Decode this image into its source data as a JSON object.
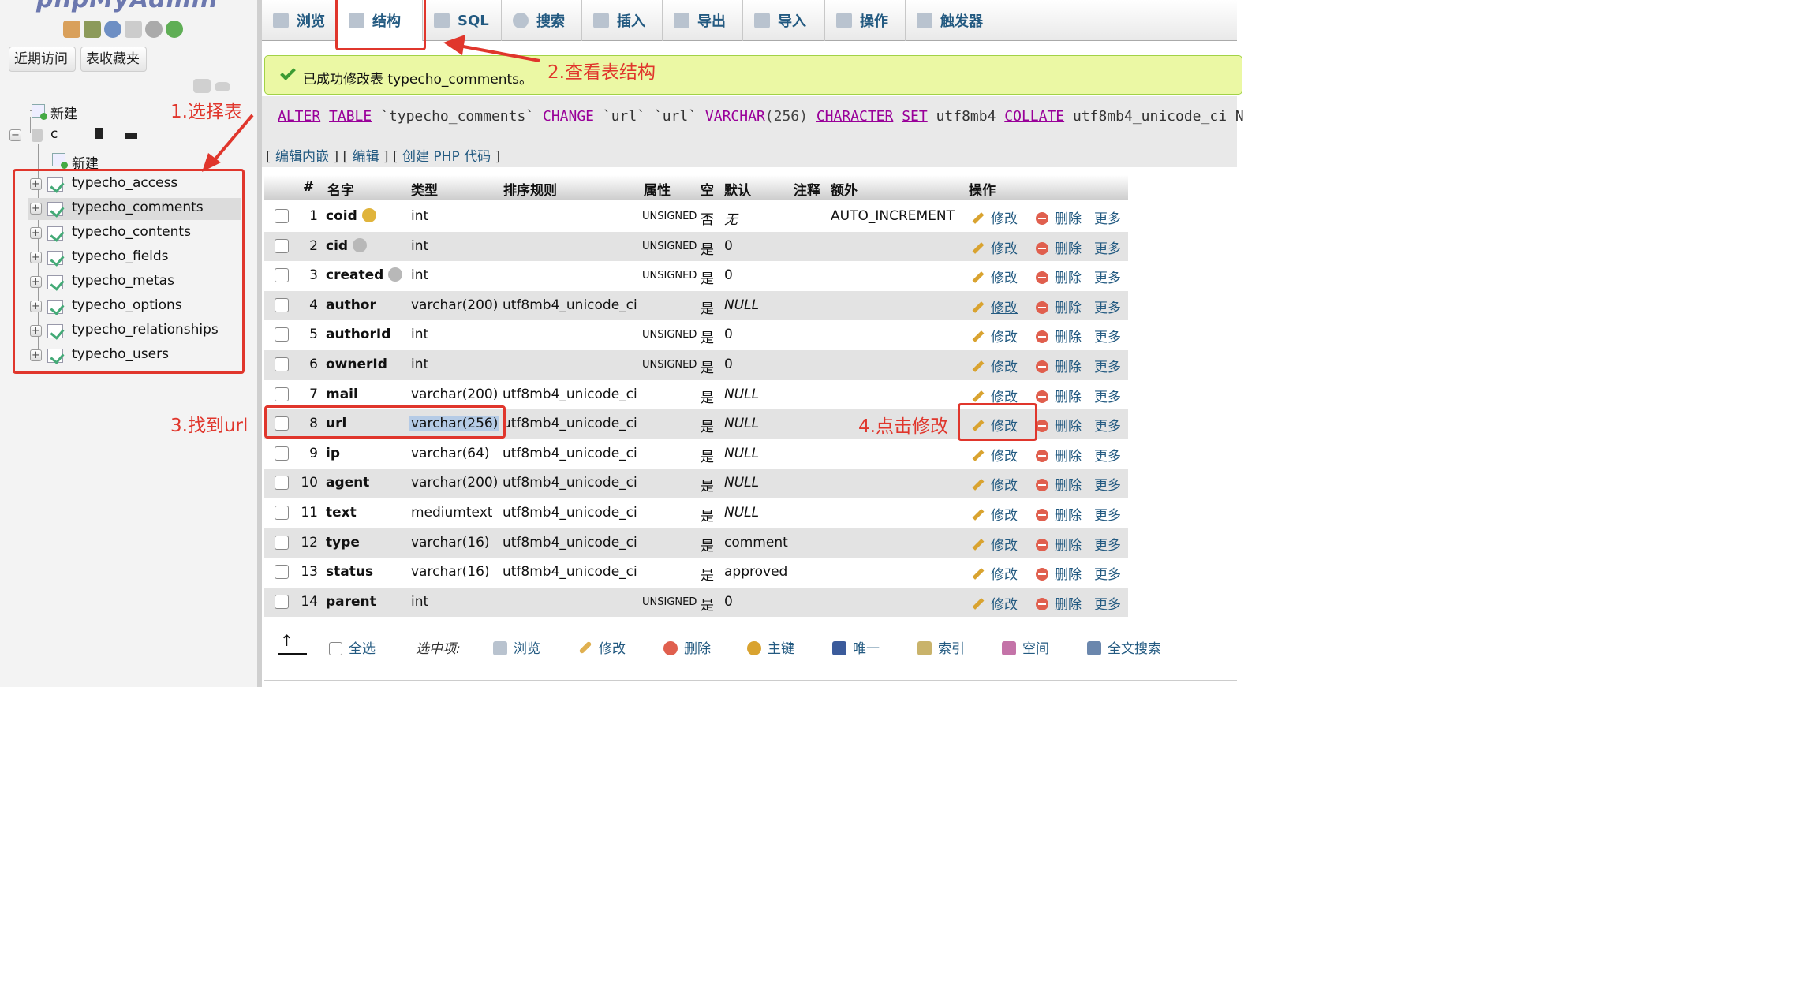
{
  "sidebar": {
    "logo": "phpMyAdmin",
    "buttons": {
      "recent": "近期访问",
      "favorites": "表收藏夹"
    },
    "tree": {
      "new_root": "新建",
      "db_name": "c",
      "new_in_db": "新建",
      "tables": [
        "typecho_access",
        "typecho_comments",
        "typecho_contents",
        "typecho_fields",
        "typecho_metas",
        "typecho_options",
        "typecho_relationships",
        "typecho_users"
      ],
      "selected_table": "typecho_comments"
    }
  },
  "tabs": [
    {
      "label": "浏览",
      "icon": "browse-icon"
    },
    {
      "label": "结构",
      "icon": "structure-icon"
    },
    {
      "label": "SQL",
      "icon": "sql-icon"
    },
    {
      "label": "搜索",
      "icon": "search-icon"
    },
    {
      "label": "插入",
      "icon": "insert-icon"
    },
    {
      "label": "导出",
      "icon": "export-icon"
    },
    {
      "label": "导入",
      "icon": "import-icon"
    },
    {
      "label": "操作",
      "icon": "wrench-icon"
    },
    {
      "label": "触发器",
      "icon": "trigger-icon"
    }
  ],
  "message": {
    "success": "已成功修改表 typecho_comments。",
    "sql": {
      "alter": "ALTER",
      "table": "TABLE",
      "tbl": "`typecho_comments`",
      "change": "CHANGE",
      "col1": "`url`",
      "col2": "`url`",
      "type": "VARCHAR",
      "len": "(256)",
      "character": "CHARACTER",
      "set": "SET",
      "charset": "utf8mb4",
      "collate": "COLLATE",
      "collation": "utf8mb4_unicode_ci",
      "tail": "N"
    },
    "links": {
      "inline_edit": "编辑内嵌",
      "edit": "编辑",
      "php_code": "创建 PHP 代码"
    }
  },
  "structure": {
    "headers": {
      "num": "#",
      "name": "名字",
      "type": "类型",
      "collation": "排序规则",
      "attributes": "属性",
      "null": "空",
      "default": "默认",
      "comment": "注释",
      "extra": "额外",
      "action": "操作"
    },
    "actions": {
      "edit": "修改",
      "delete": "删除",
      "more": "更多"
    },
    "rows": [
      {
        "num": "1",
        "name": "coid",
        "type": "int",
        "collation": "",
        "attr": "UNSIGNED",
        "null": "否",
        "default": "无",
        "extra": "AUTO_INCREMENT",
        "key": "primary"
      },
      {
        "num": "2",
        "name": "cid",
        "type": "int",
        "collation": "",
        "attr": "UNSIGNED",
        "null": "是",
        "default": "0",
        "extra": "",
        "key": "index"
      },
      {
        "num": "3",
        "name": "created",
        "type": "int",
        "collation": "",
        "attr": "UNSIGNED",
        "null": "是",
        "default": "0",
        "extra": "",
        "key": "index"
      },
      {
        "num": "4",
        "name": "author",
        "type": "varchar(200)",
        "collation": "utf8mb4_unicode_ci",
        "attr": "",
        "null": "是",
        "default": "NULL",
        "extra": "",
        "key": ""
      },
      {
        "num": "5",
        "name": "authorId",
        "type": "int",
        "collation": "",
        "attr": "UNSIGNED",
        "null": "是",
        "default": "0",
        "extra": "",
        "key": ""
      },
      {
        "num": "6",
        "name": "ownerId",
        "type": "int",
        "collation": "",
        "attr": "UNSIGNED",
        "null": "是",
        "default": "0",
        "extra": "",
        "key": ""
      },
      {
        "num": "7",
        "name": "mail",
        "type": "varchar(200)",
        "collation": "utf8mb4_unicode_ci",
        "attr": "",
        "null": "是",
        "default": "NULL",
        "extra": "",
        "key": ""
      },
      {
        "num": "8",
        "name": "url",
        "type": "varchar(256)",
        "collation": "utf8mb4_unicode_ci",
        "attr": "",
        "null": "是",
        "default": "NULL",
        "extra": "",
        "key": ""
      },
      {
        "num": "9",
        "name": "ip",
        "type": "varchar(64)",
        "collation": "utf8mb4_unicode_ci",
        "attr": "",
        "null": "是",
        "default": "NULL",
        "extra": "",
        "key": ""
      },
      {
        "num": "10",
        "name": "agent",
        "type": "varchar(200)",
        "collation": "utf8mb4_unicode_ci",
        "attr": "",
        "null": "是",
        "default": "NULL",
        "extra": "",
        "key": ""
      },
      {
        "num": "11",
        "name": "text",
        "type": "mediumtext",
        "collation": "utf8mb4_unicode_ci",
        "attr": "",
        "null": "是",
        "default": "NULL",
        "extra": "",
        "key": ""
      },
      {
        "num": "12",
        "name": "type",
        "type": "varchar(16)",
        "collation": "utf8mb4_unicode_ci",
        "attr": "",
        "null": "是",
        "default": "comment",
        "extra": "",
        "key": ""
      },
      {
        "num": "13",
        "name": "status",
        "type": "varchar(16)",
        "collation": "utf8mb4_unicode_ci",
        "attr": "",
        "null": "是",
        "default": "approved",
        "extra": "",
        "key": ""
      },
      {
        "num": "14",
        "name": "parent",
        "type": "int",
        "collation": "",
        "attr": "UNSIGNED",
        "null": "是",
        "default": "0",
        "extra": "",
        "key": ""
      }
    ]
  },
  "bulk": {
    "select_all": "全选",
    "with_selected": "选中项:",
    "browse": "浏览",
    "edit": "修改",
    "delete": "删除",
    "primary": "主键",
    "unique": "唯一",
    "index": "索引",
    "spatial": "空间",
    "fulltext": "全文搜索"
  },
  "annotations": {
    "step1": "1.选择表",
    "step2": "2.查看表结构",
    "step3": "3.找到url",
    "step4": "4.点击修改"
  },
  "colors": {
    "annotation": "#e0362c",
    "link": "#235a81",
    "success_bg": "#ebf8a4"
  }
}
